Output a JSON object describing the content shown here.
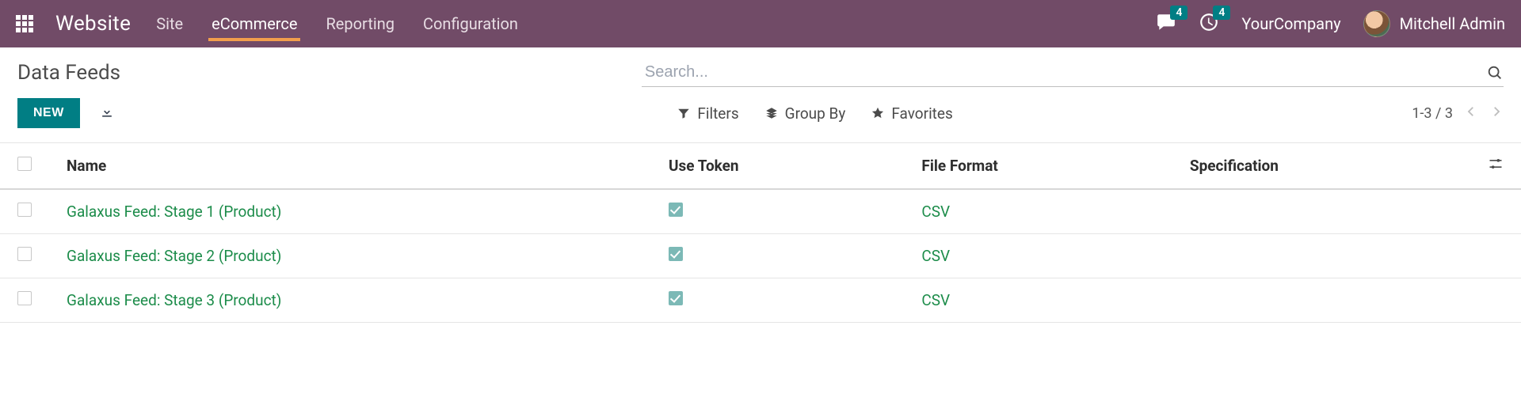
{
  "nav": {
    "brand": "Website",
    "items": [
      {
        "label": "Site",
        "active": false
      },
      {
        "label": "eCommerce",
        "active": true
      },
      {
        "label": "Reporting",
        "active": false
      },
      {
        "label": "Configuration",
        "active": false
      }
    ],
    "messages_badge": "4",
    "activities_badge": "4",
    "company": "YourCompany",
    "user": "Mitchell Admin"
  },
  "page": {
    "title": "Data Feeds",
    "new_button": "NEW",
    "search_placeholder": "Search...",
    "filters_label": "Filters",
    "groupby_label": "Group By",
    "favorites_label": "Favorites",
    "pager": "1-3 / 3"
  },
  "table": {
    "columns": {
      "name": "Name",
      "use_token": "Use Token",
      "file_format": "File Format",
      "specification": "Specification"
    },
    "rows": [
      {
        "name": "Galaxus Feed: Stage 1 (Product)",
        "use_token": true,
        "file_format": "CSV",
        "specification": ""
      },
      {
        "name": "Galaxus Feed: Stage 2 (Product)",
        "use_token": true,
        "file_format": "CSV",
        "specification": ""
      },
      {
        "name": "Galaxus Feed: Stage 3 (Product)",
        "use_token": true,
        "file_format": "CSV",
        "specification": ""
      }
    ]
  }
}
